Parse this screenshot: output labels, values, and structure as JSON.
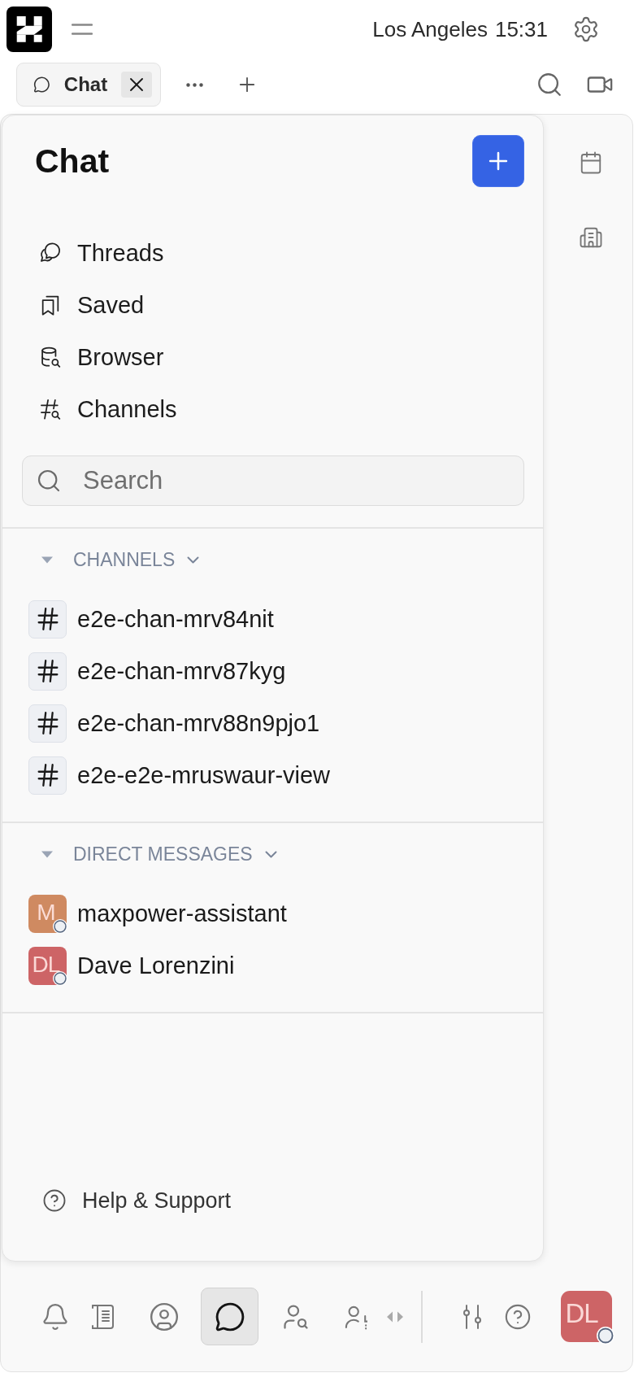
{
  "header": {
    "location": "Los Angeles",
    "time": "15:31"
  },
  "tabs": [
    {
      "label": "Chat",
      "selected": true
    }
  ],
  "panel": {
    "title": "Chat",
    "nav_items": [
      {
        "label": "Threads",
        "kind": "threads"
      },
      {
        "label": "Saved",
        "kind": "saved"
      },
      {
        "label": "Browser",
        "kind": "browser"
      },
      {
        "label": "Channels",
        "kind": "channels"
      }
    ],
    "search": {
      "placeholder": "Search"
    },
    "sections": [
      {
        "kind": "channels",
        "title": "CHANNELS",
        "expanded": true,
        "items": [
          {
            "name": "e2e-chan-mrv84nit"
          },
          {
            "name": "e2e-chan-mrv87kyg"
          },
          {
            "name": "e2e-chan-mrv88n9pjo1"
          },
          {
            "name": "e2e-e2e-mruswaur-view"
          }
        ]
      },
      {
        "kind": "direct_messages",
        "title": "DIRECT MESSAGES",
        "expanded": true,
        "items": [
          {
            "name": "maxpower-assistant",
            "initials": "M",
            "color": "#cf8a61",
            "online": false
          },
          {
            "name": "Dave Lorenzini",
            "initials": "DL",
            "color": "#cd6466",
            "online": false
          }
        ]
      }
    ],
    "help": {
      "label": "Help & Support"
    }
  },
  "bottom_bar": {
    "items": [
      {
        "kind": "bell",
        "selected": false
      },
      {
        "kind": "notebook",
        "selected": false
      },
      {
        "kind": "profile",
        "selected": false
      },
      {
        "kind": "chat",
        "selected": true
      },
      {
        "kind": "user_search",
        "selected": false
      },
      {
        "kind": "user_list",
        "selected": false
      }
    ],
    "tools": [
      {
        "kind": "sliders"
      },
      {
        "kind": "help"
      }
    ],
    "user": {
      "initials": "DL",
      "color": "#cd6466",
      "online": false
    }
  }
}
